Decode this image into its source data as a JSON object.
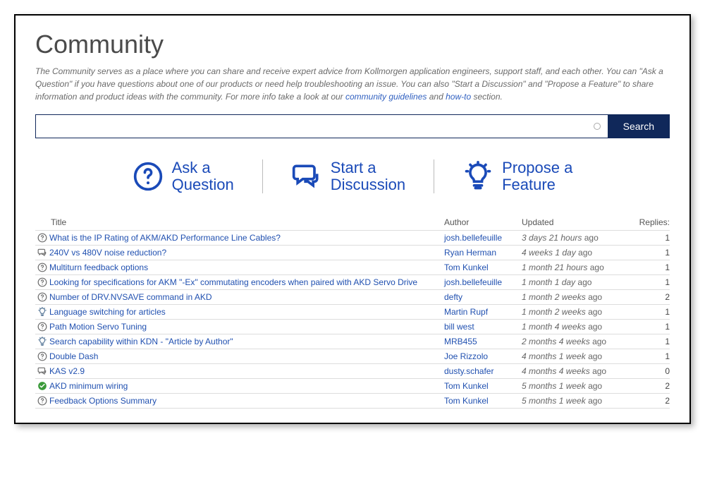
{
  "title": "Community",
  "description": {
    "text1": "The Community serves as a place where you can share and receive expert advice from Kollmorgen application engineers, support staff, and each other. You can \"Ask a Question\" if you have questions about one of our products or need help troubleshooting an issue. You can also \"Start a Discussion\" and \"Propose a Feature\" to share information and product ideas with the community. For more info take a look at our ",
    "link1": "community guidelines",
    "mid": " and ",
    "link2": "how-to",
    "end": " section."
  },
  "search": {
    "buttonLabel": "Search"
  },
  "actions": [
    {
      "line1": "Ask a",
      "line2": "Question",
      "icon": "question"
    },
    {
      "line1": "Start a",
      "line2": "Discussion",
      "icon": "discussion"
    },
    {
      "line1": "Propose a",
      "line2": "Feature",
      "icon": "idea"
    }
  ],
  "columns": {
    "title": "Title",
    "author": "Author",
    "updated": "Updated",
    "replies": "Replies:"
  },
  "ago_suffix": " ago",
  "rows": [
    {
      "icon": "question",
      "title": "What is the IP Rating of AKM/AKD Performance Line Cables?",
      "author": "josh.bellefeuille",
      "updated": "3 days 21 hours",
      "replies": "1"
    },
    {
      "icon": "discussion",
      "title": "240V vs 480V noise reduction?",
      "author": "Ryan Herman",
      "updated": "4 weeks 1 day",
      "replies": "1"
    },
    {
      "icon": "question",
      "title": "Multiturn feedback options",
      "author": "Tom Kunkel",
      "updated": "1 month 21 hours",
      "replies": "1"
    },
    {
      "icon": "question",
      "title": "Looking for specifications for AKM \"-Ex\" commutating encoders when paired with AKD Servo Drive",
      "author": "josh.bellefeuille",
      "updated": "1 month 1 day",
      "replies": "1"
    },
    {
      "icon": "question",
      "title": "Number of DRV.NVSAVE command in AKD",
      "author": "defty",
      "updated": "1 month 2 weeks",
      "replies": "2"
    },
    {
      "icon": "idea",
      "title": "Language switching for articles",
      "author": "Martin Rupf",
      "updated": "1 month 2 weeks",
      "replies": "1"
    },
    {
      "icon": "question",
      "title": "Path Motion Servo Tuning",
      "author": "bill west",
      "updated": "1 month 4 weeks",
      "replies": "1"
    },
    {
      "icon": "idea",
      "title": "Search capability within KDN - \"Article by Author\"",
      "author": "MRB455",
      "updated": "2 months 4 weeks",
      "replies": "1"
    },
    {
      "icon": "question",
      "title": "Double Dash",
      "author": "Joe Rizzolo",
      "updated": "4 months 1 week",
      "replies": "1"
    },
    {
      "icon": "discussion",
      "title": "KAS v2.9",
      "author": "dusty.schafer",
      "updated": "4 months 4 weeks",
      "replies": "0"
    },
    {
      "icon": "check",
      "title": "AKD minimum wiring",
      "author": "Tom Kunkel",
      "updated": "5 months 1 week",
      "replies": "2"
    },
    {
      "icon": "question",
      "title": "Feedback Options Summary",
      "author": "Tom Kunkel",
      "updated": "5 months 1 week",
      "replies": "2"
    }
  ]
}
